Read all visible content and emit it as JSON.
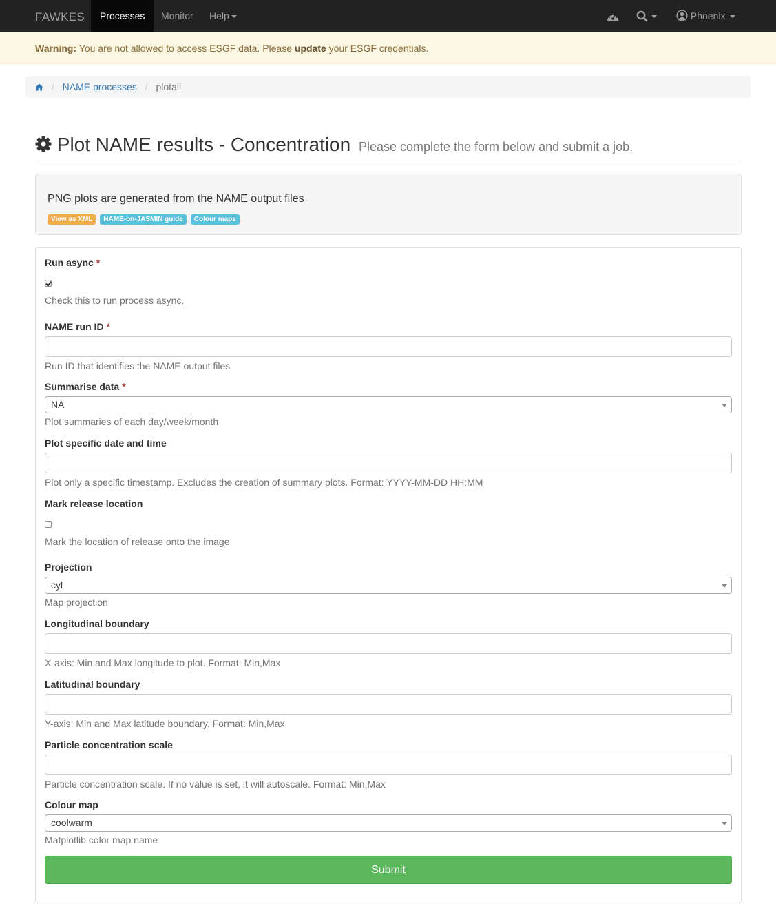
{
  "navbar": {
    "brand": "FAWKES",
    "items": [
      {
        "label": "Processes",
        "active": true
      },
      {
        "label": "Monitor",
        "active": false
      },
      {
        "label": "Help",
        "active": false
      }
    ],
    "user": "Phoenix",
    "icons": [
      "dashboard-icon",
      "search-icon",
      "user-circle-icon"
    ]
  },
  "warning": {
    "prefix": "Warning:",
    "text1": " You are not allowed to access ESGF data. Please ",
    "strong": "update",
    "text2": " your ESGF credentials."
  },
  "breadcrumb": {
    "home_icon": "home-icon",
    "link": "NAME processes",
    "current": "plotall"
  },
  "header": {
    "title": "Plot NAME results - Concentration",
    "subtitle": "Please complete the form below and submit a job.",
    "icon": "gear-icon"
  },
  "info": {
    "description": "PNG plots are generated from the NAME output files",
    "labels": [
      "View as XML",
      "NAME-on-JASMIN guide",
      "Colour maps"
    ]
  },
  "form": {
    "run_async": {
      "label": "Run async",
      "required": "*",
      "checked": true,
      "help": "Check this to run process async."
    },
    "run_id": {
      "label": "NAME run ID",
      "required": "*",
      "value": "",
      "help": "Run ID that identifies the NAME output files"
    },
    "summarise": {
      "label": "Summarise data",
      "required": "*",
      "value": "NA",
      "help": "Plot summaries of each day/week/month"
    },
    "timestamp": {
      "label": "Plot specific date and time",
      "value": "",
      "help": "Plot only a specific timestamp. Excludes the creation of summary plots. Format: YYYY-MM-DD HH:MM"
    },
    "mark_release": {
      "label": "Mark release location",
      "checked": false,
      "help": "Mark the location of release onto the image"
    },
    "projection": {
      "label": "Projection",
      "value": "cyl",
      "help": "Map projection"
    },
    "lon_bounds": {
      "label": "Longitudinal boundary",
      "value": "",
      "help": "X-axis: Min and Max longitude to plot. Format: Min,Max"
    },
    "lat_bounds": {
      "label": "Latitudinal boundary",
      "value": "",
      "help": "Y-axis: Min and Max latitude boundary. Format: Min,Max"
    },
    "scale": {
      "label": "Particle concentration scale",
      "value": "",
      "help": "Particle concentration scale. If no value is set, it will autoscale. Format: Min,Max"
    },
    "colour_map": {
      "label": "Colour map",
      "value": "coolwarm",
      "help": "Matplotlib color map name"
    },
    "submit_label": "Submit"
  },
  "colors": {
    "primary": "#337ab7",
    "success": "#5cb85c",
    "warning": "#f0ad4e",
    "info": "#5bc0de",
    "navbar": "#222222"
  }
}
